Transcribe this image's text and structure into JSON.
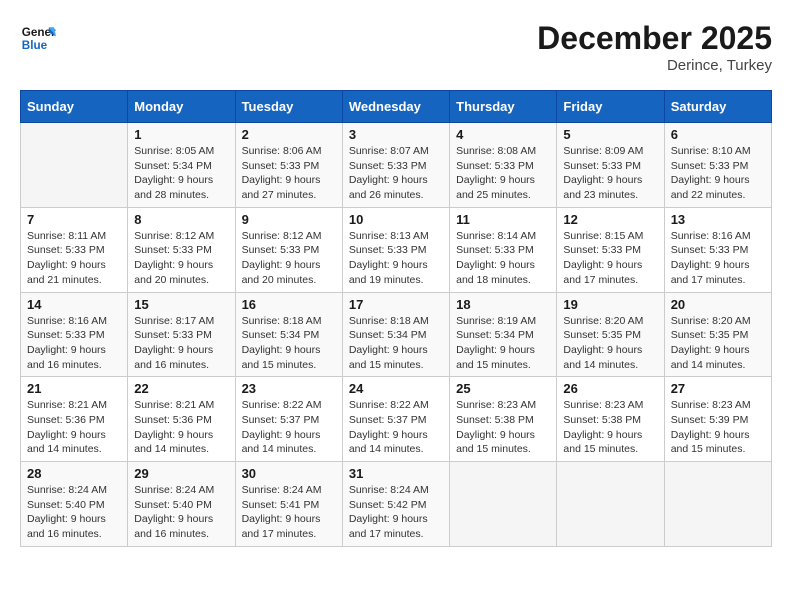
{
  "header": {
    "logo_general": "General",
    "logo_blue": "Blue",
    "month_title": "December 2025",
    "location": "Derince, Turkey"
  },
  "calendar": {
    "days_of_week": [
      "Sunday",
      "Monday",
      "Tuesday",
      "Wednesday",
      "Thursday",
      "Friday",
      "Saturday"
    ],
    "weeks": [
      [
        {
          "day": "",
          "sunrise": "",
          "sunset": "",
          "daylight": "",
          "empty": true
        },
        {
          "day": "1",
          "sunrise": "Sunrise: 8:05 AM",
          "sunset": "Sunset: 5:34 PM",
          "daylight": "Daylight: 9 hours and 28 minutes."
        },
        {
          "day": "2",
          "sunrise": "Sunrise: 8:06 AM",
          "sunset": "Sunset: 5:33 PM",
          "daylight": "Daylight: 9 hours and 27 minutes."
        },
        {
          "day": "3",
          "sunrise": "Sunrise: 8:07 AM",
          "sunset": "Sunset: 5:33 PM",
          "daylight": "Daylight: 9 hours and 26 minutes."
        },
        {
          "day": "4",
          "sunrise": "Sunrise: 8:08 AM",
          "sunset": "Sunset: 5:33 PM",
          "daylight": "Daylight: 9 hours and 25 minutes."
        },
        {
          "day": "5",
          "sunrise": "Sunrise: 8:09 AM",
          "sunset": "Sunset: 5:33 PM",
          "daylight": "Daylight: 9 hours and 23 minutes."
        },
        {
          "day": "6",
          "sunrise": "Sunrise: 8:10 AM",
          "sunset": "Sunset: 5:33 PM",
          "daylight": "Daylight: 9 hours and 22 minutes."
        }
      ],
      [
        {
          "day": "7",
          "sunrise": "Sunrise: 8:11 AM",
          "sunset": "Sunset: 5:33 PM",
          "daylight": "Daylight: 9 hours and 21 minutes."
        },
        {
          "day": "8",
          "sunrise": "Sunrise: 8:12 AM",
          "sunset": "Sunset: 5:33 PM",
          "daylight": "Daylight: 9 hours and 20 minutes."
        },
        {
          "day": "9",
          "sunrise": "Sunrise: 8:12 AM",
          "sunset": "Sunset: 5:33 PM",
          "daylight": "Daylight: 9 hours and 20 minutes."
        },
        {
          "day": "10",
          "sunrise": "Sunrise: 8:13 AM",
          "sunset": "Sunset: 5:33 PM",
          "daylight": "Daylight: 9 hours and 19 minutes."
        },
        {
          "day": "11",
          "sunrise": "Sunrise: 8:14 AM",
          "sunset": "Sunset: 5:33 PM",
          "daylight": "Daylight: 9 hours and 18 minutes."
        },
        {
          "day": "12",
          "sunrise": "Sunrise: 8:15 AM",
          "sunset": "Sunset: 5:33 PM",
          "daylight": "Daylight: 9 hours and 17 minutes."
        },
        {
          "day": "13",
          "sunrise": "Sunrise: 8:16 AM",
          "sunset": "Sunset: 5:33 PM",
          "daylight": "Daylight: 9 hours and 17 minutes."
        }
      ],
      [
        {
          "day": "14",
          "sunrise": "Sunrise: 8:16 AM",
          "sunset": "Sunset: 5:33 PM",
          "daylight": "Daylight: 9 hours and 16 minutes."
        },
        {
          "day": "15",
          "sunrise": "Sunrise: 8:17 AM",
          "sunset": "Sunset: 5:33 PM",
          "daylight": "Daylight: 9 hours and 16 minutes."
        },
        {
          "day": "16",
          "sunrise": "Sunrise: 8:18 AM",
          "sunset": "Sunset: 5:34 PM",
          "daylight": "Daylight: 9 hours and 15 minutes."
        },
        {
          "day": "17",
          "sunrise": "Sunrise: 8:18 AM",
          "sunset": "Sunset: 5:34 PM",
          "daylight": "Daylight: 9 hours and 15 minutes."
        },
        {
          "day": "18",
          "sunrise": "Sunrise: 8:19 AM",
          "sunset": "Sunset: 5:34 PM",
          "daylight": "Daylight: 9 hours and 15 minutes."
        },
        {
          "day": "19",
          "sunrise": "Sunrise: 8:20 AM",
          "sunset": "Sunset: 5:35 PM",
          "daylight": "Daylight: 9 hours and 14 minutes."
        },
        {
          "day": "20",
          "sunrise": "Sunrise: 8:20 AM",
          "sunset": "Sunset: 5:35 PM",
          "daylight": "Daylight: 9 hours and 14 minutes."
        }
      ],
      [
        {
          "day": "21",
          "sunrise": "Sunrise: 8:21 AM",
          "sunset": "Sunset: 5:36 PM",
          "daylight": "Daylight: 9 hours and 14 minutes."
        },
        {
          "day": "22",
          "sunrise": "Sunrise: 8:21 AM",
          "sunset": "Sunset: 5:36 PM",
          "daylight": "Daylight: 9 hours and 14 minutes."
        },
        {
          "day": "23",
          "sunrise": "Sunrise: 8:22 AM",
          "sunset": "Sunset: 5:37 PM",
          "daylight": "Daylight: 9 hours and 14 minutes."
        },
        {
          "day": "24",
          "sunrise": "Sunrise: 8:22 AM",
          "sunset": "Sunset: 5:37 PM",
          "daylight": "Daylight: 9 hours and 14 minutes."
        },
        {
          "day": "25",
          "sunrise": "Sunrise: 8:23 AM",
          "sunset": "Sunset: 5:38 PM",
          "daylight": "Daylight: 9 hours and 15 minutes."
        },
        {
          "day": "26",
          "sunrise": "Sunrise: 8:23 AM",
          "sunset": "Sunset: 5:38 PM",
          "daylight": "Daylight: 9 hours and 15 minutes."
        },
        {
          "day": "27",
          "sunrise": "Sunrise: 8:23 AM",
          "sunset": "Sunset: 5:39 PM",
          "daylight": "Daylight: 9 hours and 15 minutes."
        }
      ],
      [
        {
          "day": "28",
          "sunrise": "Sunrise: 8:24 AM",
          "sunset": "Sunset: 5:40 PM",
          "daylight": "Daylight: 9 hours and 16 minutes."
        },
        {
          "day": "29",
          "sunrise": "Sunrise: 8:24 AM",
          "sunset": "Sunset: 5:40 PM",
          "daylight": "Daylight: 9 hours and 16 minutes."
        },
        {
          "day": "30",
          "sunrise": "Sunrise: 8:24 AM",
          "sunset": "Sunset: 5:41 PM",
          "daylight": "Daylight: 9 hours and 17 minutes."
        },
        {
          "day": "31",
          "sunrise": "Sunrise: 8:24 AM",
          "sunset": "Sunset: 5:42 PM",
          "daylight": "Daylight: 9 hours and 17 minutes."
        },
        {
          "day": "",
          "sunrise": "",
          "sunset": "",
          "daylight": "",
          "empty": true
        },
        {
          "day": "",
          "sunrise": "",
          "sunset": "",
          "daylight": "",
          "empty": true
        },
        {
          "day": "",
          "sunrise": "",
          "sunset": "",
          "daylight": "",
          "empty": true
        }
      ]
    ]
  }
}
